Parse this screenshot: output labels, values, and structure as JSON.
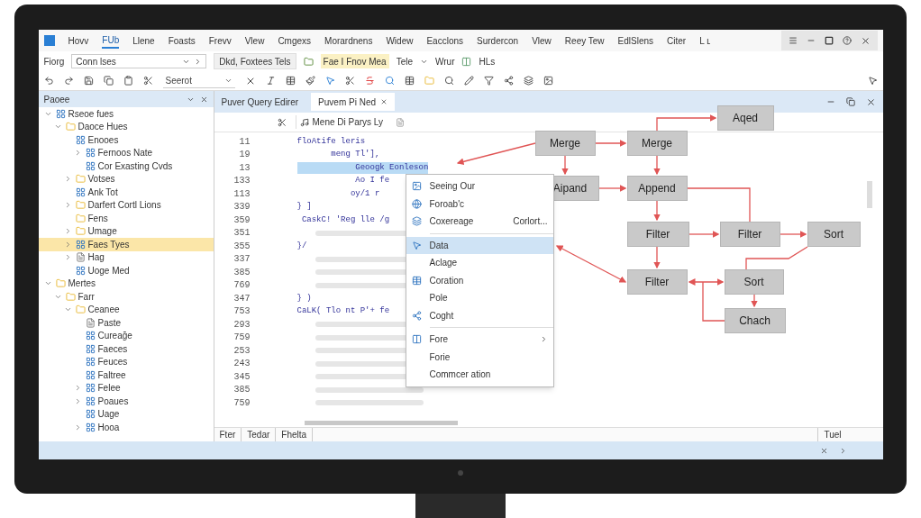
{
  "menu_bar": [
    {
      "label": "Hovv",
      "selected": false
    },
    {
      "label": "FUb",
      "selected": true
    },
    {
      "label": "Llene",
      "selected": false
    },
    {
      "label": "Foasts",
      "selected": false
    },
    {
      "label": "Frevv",
      "selected": false
    },
    {
      "label": "Vlew",
      "selected": false
    },
    {
      "label": "Cmgexs",
      "selected": false
    },
    {
      "label": "Morardnens",
      "selected": false
    },
    {
      "label": "Widew",
      "selected": false
    },
    {
      "label": "Eacclons",
      "selected": false
    },
    {
      "label": "Surdercon",
      "selected": false
    },
    {
      "label": "Vlew",
      "selected": false
    },
    {
      "label": "Reey Tew",
      "selected": false
    },
    {
      "label": "EdlSlens",
      "selected": false
    },
    {
      "label": "Citer",
      "selected": false
    },
    {
      "label": "L ʟ",
      "selected": false
    }
  ],
  "toolbar": {
    "label": "Fiorg",
    "dropdown": "Conn lses",
    "buttons": [
      "Dkd, Foxtees Tels",
      "Fae I Fnov Mea",
      "Tele",
      "Wrur",
      "HLs"
    ],
    "font": "Seerot"
  },
  "side_panel": {
    "title": "Paoee",
    "tree": [
      {
        "label": "Rseoe fues",
        "kind": "app",
        "selected": false,
        "expanded": true,
        "children": [
          {
            "label": "Daoce Hues",
            "kind": "folder",
            "selected": false,
            "expanded": true,
            "children": [
              {
                "label": "Enooes",
                "kind": "app",
                "selected": false,
                "children": [
                  {
                    "label": "Fernoos Nate",
                    "kind": "app",
                    "selected": false,
                    "expanded": false
                  },
                  {
                    "label": "Cor Exasting Cvds",
                    "kind": "app",
                    "selected": false
                  }
                ]
              },
              {
                "label": "Votses",
                "kind": "folder",
                "selected": false,
                "expanded": false
              },
              {
                "label": "Ank Tot",
                "kind": "app",
                "selected": false
              },
              {
                "label": "Darfert Cortl Lions",
                "kind": "folder",
                "selected": false,
                "expanded": false
              },
              {
                "label": "Fens",
                "kind": "folder",
                "selected": false
              },
              {
                "label": "Umage",
                "kind": "folder",
                "selected": false,
                "expanded": false
              },
              {
                "label": "Faes Tyes",
                "kind": "app",
                "selected": true,
                "expanded": false
              },
              {
                "label": "Hag",
                "kind": "file",
                "selected": false,
                "expanded": false
              },
              {
                "label": "Uoge Med",
                "kind": "app",
                "selected": false
              }
            ]
          }
        ]
      },
      {
        "label": "Mertes",
        "kind": "folder",
        "selected": false,
        "expanded": true,
        "children": [
          {
            "label": "Farr",
            "kind": "folder",
            "selected": false,
            "expanded": true,
            "children": [
              {
                "label": "Ceanee",
                "kind": "folder",
                "selected": false,
                "expanded": true,
                "children": [
                  {
                    "label": "Paste",
                    "kind": "file",
                    "selected": false
                  },
                  {
                    "label": "Cureağe",
                    "kind": "app",
                    "selected": false
                  },
                  {
                    "label": "Faeces",
                    "kind": "app",
                    "selected": false
                  },
                  {
                    "label": "Feuces",
                    "kind": "app",
                    "selected": false
                  },
                  {
                    "label": "Faltree",
                    "kind": "app",
                    "selected": false
                  },
                  {
                    "label": "Felee",
                    "kind": "app",
                    "selected": false,
                    "expanded": false
                  },
                  {
                    "label": "Poaues",
                    "kind": "app",
                    "selected": false,
                    "expanded": false
                  },
                  {
                    "label": "Uage",
                    "kind": "app",
                    "selected": false
                  },
                  {
                    "label": "Hooa",
                    "kind": "app",
                    "selected": false,
                    "expanded": false
                  }
                ]
              }
            ]
          }
        ]
      }
    ]
  },
  "editor": {
    "title": "Puver Query Edirer",
    "tabs": [
      {
        "label": "Puvem Pi Ned",
        "selected": true
      }
    ],
    "query_label": "Mene Di Parys Ly",
    "code_lines": [
      {
        "number": "11",
        "kind": "code",
        "text": "floAtife leris",
        "selected": false
      },
      {
        "number": "19",
        "kind": "code",
        "text": "       meng Tl'],",
        "selected": false
      },
      {
        "number": "13",
        "kind": "code",
        "text": "            Geoogk Eonleson",
        "selected": true
      },
      {
        "number": "133",
        "kind": "code",
        "text": "            Ao I fe",
        "selected": false
      },
      {
        "number": "113",
        "kind": "code",
        "text": "           oy/1 r",
        "selected": false
      },
      {
        "number": "339",
        "kind": "code",
        "text": "} ]",
        "selected": false
      },
      {
        "number": "359",
        "kind": "code",
        "text": " CaskC! 'Reg lle /g",
        "selected": false
      },
      {
        "number": "351",
        "kind": "blurred",
        "selected": false
      },
      {
        "number": "355",
        "kind": "code",
        "text": "}/",
        "selected": false
      },
      {
        "number": "337",
        "kind": "blurred",
        "selected": false
      },
      {
        "number": "385",
        "kind": "blurred",
        "selected": false
      },
      {
        "number": "769",
        "kind": "blurred",
        "selected": false
      },
      {
        "number": "347",
        "kind": "code",
        "text": "} )",
        "selected": false
      },
      {
        "number": "753",
        "kind": "code",
        "text": "CaLK( Tlo nt P'+ fe",
        "selected": false
      },
      {
        "number": "293",
        "kind": "blurred",
        "selected": false
      },
      {
        "number": "759",
        "kind": "blurred",
        "selected": false
      },
      {
        "number": "253",
        "kind": "blurred",
        "selected": false
      },
      {
        "number": "243",
        "kind": "blurred",
        "selected": false
      },
      {
        "number": "345",
        "kind": "blurred",
        "selected": false
      },
      {
        "number": "385",
        "kind": "blurred",
        "selected": false
      },
      {
        "number": "759",
        "kind": "blurred",
        "selected": false
      }
    ],
    "context_menu": [
      {
        "kind": "item",
        "icon": true,
        "label": "Seeing Our",
        "selected": false
      },
      {
        "kind": "item",
        "icon": true,
        "label": "Foroab'c",
        "selected": false
      },
      {
        "kind": "item",
        "icon": true,
        "label": "Coxereage",
        "shortcut": "Corlort...",
        "selected": false
      },
      {
        "kind": "separator"
      },
      {
        "kind": "item",
        "icon": true,
        "label": "Data",
        "selected": true
      },
      {
        "kind": "item",
        "icon": false,
        "label": "Aclage",
        "selected": false
      },
      {
        "kind": "item",
        "icon": true,
        "label": "Coration",
        "selected": false
      },
      {
        "kind": "item",
        "icon": false,
        "label": "Pole",
        "selected": false
      },
      {
        "kind": "item",
        "icon": true,
        "label": "Coght",
        "selected": false
      },
      {
        "kind": "separator"
      },
      {
        "kind": "item",
        "icon": true,
        "label": "Fore",
        "submenu": true,
        "selected": false
      },
      {
        "kind": "item",
        "icon": false,
        "label": "Forie",
        "selected": false
      },
      {
        "kind": "item",
        "icon": false,
        "label": "Commcer ation",
        "selected": false
      }
    ],
    "diagram_nodes": [
      "Aqed",
      "Merge",
      "Merge",
      "Aipand",
      "Append",
      "Filter",
      "Filter",
      "Sort",
      "Filter",
      "Sort",
      "Chach"
    ],
    "status_bar": [
      "Fter",
      "Tedar",
      "Fhelta"
    ],
    "status_right": "Tuel"
  }
}
